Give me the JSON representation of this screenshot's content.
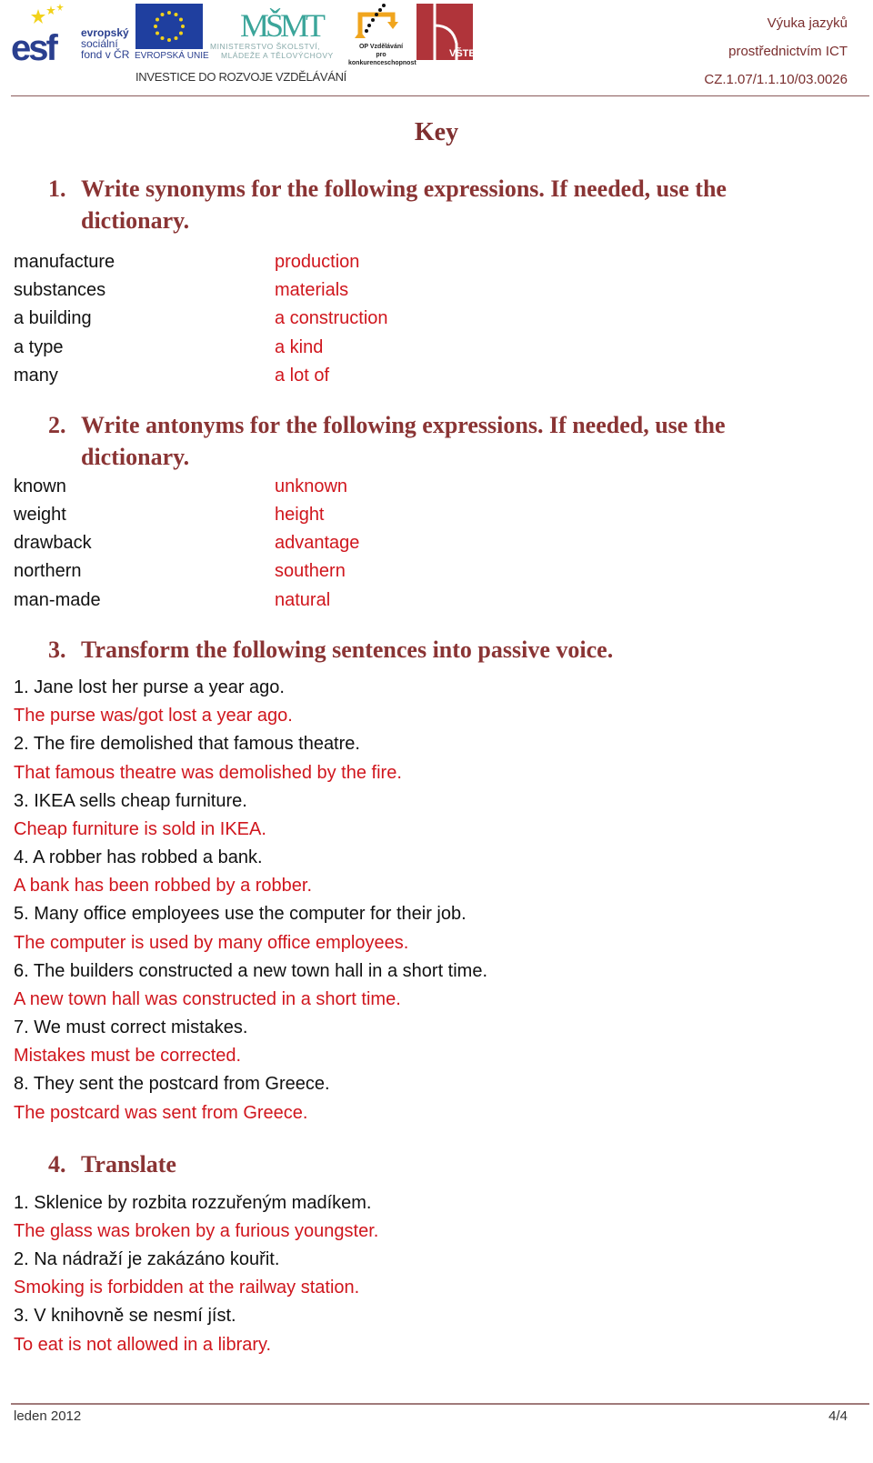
{
  "header": {
    "logos": {
      "esf": {
        "line1": "evropský",
        "line2": "sociální",
        "line3": "fond v ČR",
        "mark": "esf"
      },
      "eu": {
        "label": "EVROPSKÁ UNIE"
      },
      "msmt": {
        "mark": "MŠMT",
        "line1": "MINISTERSTVO ŠKOLSTVÍ,",
        "line2": "MLÁDEŽE A TĚLOVÝCHOVY"
      },
      "op": {
        "line1": "OP Vzdělávání",
        "line2": "pro konkurenceschopnost"
      },
      "vste": {
        "label": "VŠTE"
      }
    },
    "investment_slogan": "INVESTICE DO ROZVOJE VZDĚLÁVÁNÍ",
    "project": {
      "line1": "Výuka jazyků",
      "line2": "prostřednictvím ICT",
      "line3": "CZ.1.07/1.1.10/03.0026"
    }
  },
  "title": "Key",
  "sections": [
    {
      "number": "1.",
      "heading_line1": "Write synonyms for the following expressions. If needed, use the",
      "heading_line2": "dictionary.",
      "pairs": [
        {
          "word": "manufacture",
          "answer": "production"
        },
        {
          "word": "substances",
          "answer": "materials"
        },
        {
          "word": "a building",
          "answer": "a construction"
        },
        {
          "word": "a type",
          "answer": "a kind"
        },
        {
          "word": "many",
          "answer": "a lot of"
        }
      ]
    },
    {
      "number": "2.",
      "heading_line1": "Write antonyms for the following expressions. If needed, use the",
      "heading_line2": "dictionary.",
      "pairs": [
        {
          "word": "known",
          "answer": "unknown"
        },
        {
          "word": "weight",
          "answer": "height"
        },
        {
          "word": "drawback",
          "answer": "advantage"
        },
        {
          "word": "northern",
          "answer": "southern"
        },
        {
          "word": "man-made",
          "answer": "natural"
        }
      ]
    },
    {
      "number": "3.",
      "heading": "Transform the following sentences into passive voice.",
      "items": [
        {
          "question": "1. Jane lost her purse a year ago.",
          "answer": "The purse was/got lost a year ago."
        },
        {
          "question": "2. The fire demolished that famous theatre.",
          "answer": "That famous theatre was demolished by the fire."
        },
        {
          "question": "3. IKEA sells cheap furniture.",
          "answer": "Cheap furniture is sold in IKEA."
        },
        {
          "question": "4. A robber has robbed a bank.",
          "answer": "A bank has been robbed by a robber."
        },
        {
          "question": "5. Many office employees use the computer for their job.",
          "answer": "The computer is used by many office employees."
        },
        {
          "question": "6. The builders constructed a new town hall in a short time.",
          "answer": "A new town hall was constructed in a short time."
        },
        {
          "question": "7. We must correct mistakes.",
          "answer": "Mistakes must be corrected."
        },
        {
          "question": "8. They sent the postcard from Greece.",
          "answer": "The postcard was sent from Greece."
        }
      ]
    },
    {
      "number": "4.",
      "heading": "Translate",
      "items": [
        {
          "question": "1. Sklenice by rozbita rozzuřeným madíkem.",
          "answer": "The glass was broken by a furious youngster."
        },
        {
          "question": "2. Na nádraží je zakázáno kouřit.",
          "answer": "Smoking is forbidden at the railway station."
        },
        {
          "question": "3. V knihovně se nesmí jíst.",
          "answer": "To eat is not allowed in a library."
        }
      ]
    }
  ],
  "footer": {
    "date": "leden 2012",
    "page": "4/4"
  },
  "colors": {
    "heading": "#8a3434",
    "answer": "#d0161d",
    "header_text": "#7a2e2e"
  }
}
